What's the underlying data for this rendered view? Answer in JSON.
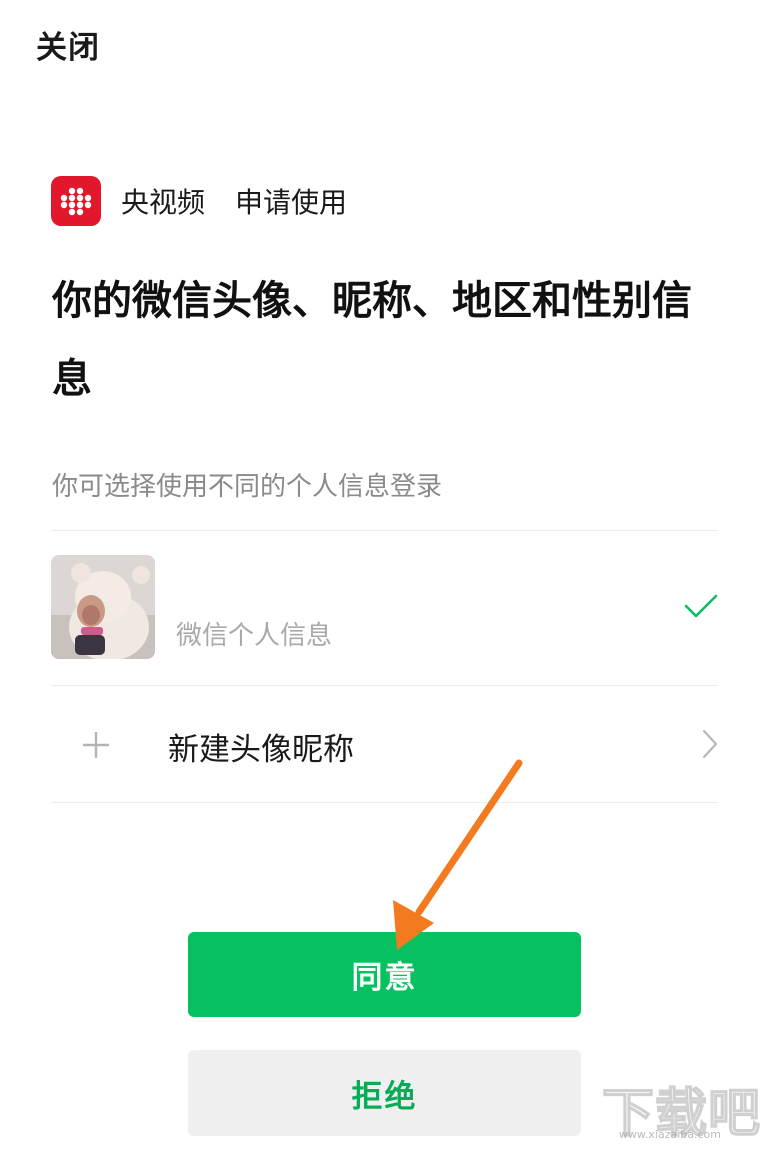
{
  "header": {
    "close_label": "关闭"
  },
  "app": {
    "name": "央视频",
    "request_text": "申请使用",
    "logo_icon": "cctv-video-logo",
    "logo_color": "#e3172b"
  },
  "permission": {
    "title": "你的微信头像、昵称、地区和性别信息",
    "subtitle": "你可选择使用不同的个人信息登录"
  },
  "options": [
    {
      "label": "微信个人信息",
      "selected": true,
      "icon": "check-icon"
    },
    {
      "label": "新建头像昵称",
      "icon": "plus-icon",
      "trailing_icon": "chevron-right-icon"
    }
  ],
  "buttons": {
    "agree_label": "同意",
    "reject_label": "拒绝"
  },
  "colors": {
    "accent": "#07c160",
    "reject_text": "#06ad56",
    "annotation_arrow": "#f47a20"
  },
  "watermark": {
    "text": "下载吧",
    "sub": "www.xiazaiba.com"
  }
}
